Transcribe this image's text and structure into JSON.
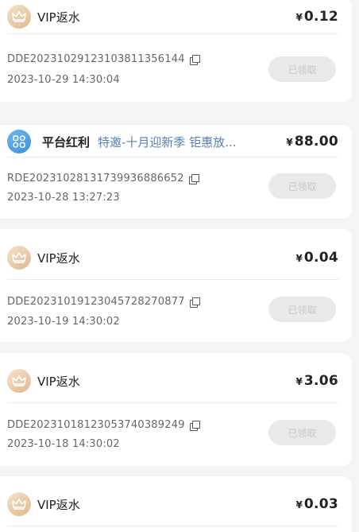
{
  "records": [
    {
      "icon": "crown-icon",
      "title": "VIP返水",
      "subtitle": "",
      "currency": "¥",
      "amount": "0.12",
      "order_no": "DDE20231029123103811356144",
      "time": "2023-10-29 14:30:04",
      "button": "已领取"
    },
    {
      "icon": "grid-icon",
      "title": "平台红利",
      "subtitle": "特邀-十月迎新季 钜惠放...",
      "currency": "¥",
      "amount": "88.00",
      "order_no": "RDE20231028131739936886652",
      "time": "2023-10-28 13:27:23",
      "button": "已领取"
    },
    {
      "icon": "crown-icon",
      "title": "VIP返水",
      "subtitle": "",
      "currency": "¥",
      "amount": "0.04",
      "order_no": "DDE20231019123045728270877",
      "time": "2023-10-19 14:30:02",
      "button": "已领取"
    },
    {
      "icon": "crown-icon",
      "title": "VIP返水",
      "subtitle": "",
      "currency": "¥",
      "amount": "3.06",
      "order_no": "DDE20231018123053740389249",
      "time": "2023-10-18 14:30:02",
      "button": "已领取"
    },
    {
      "icon": "crown-icon",
      "title": "VIP返水",
      "subtitle": "",
      "currency": "¥",
      "amount": "0.03"
    }
  ]
}
